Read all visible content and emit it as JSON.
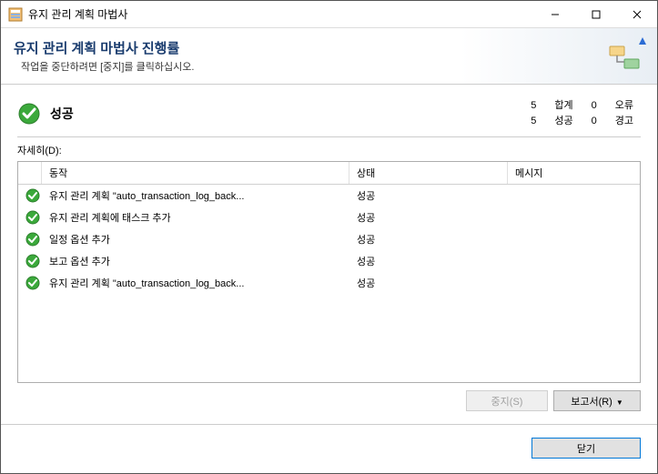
{
  "titlebar": {
    "title": "유지 관리 계획 마법사"
  },
  "banner": {
    "heading": "유지 관리 계획 마법사 진행률",
    "subtext": "작업을 중단하려면 [중지]를 클릭하십시오."
  },
  "summary": {
    "status_label": "성공",
    "stats": {
      "total_num": "5",
      "total_label": "합계",
      "error_num": "0",
      "error_label": "오류",
      "success_num": "5",
      "success_label": "성공",
      "warn_num": "0",
      "warn_label": "경고"
    }
  },
  "detail_label": "자세히(D):",
  "columns": {
    "action": "동작",
    "status": "상태",
    "message": "메시지"
  },
  "rows": [
    {
      "action": "유지 관리 계획 \"auto_transaction_log_back...",
      "status": "성공",
      "message": ""
    },
    {
      "action": "유지 관리 계획에 태스크 추가",
      "status": "성공",
      "message": ""
    },
    {
      "action": "일정 옵션 추가",
      "status": "성공",
      "message": ""
    },
    {
      "action": "보고 옵션 추가",
      "status": "성공",
      "message": ""
    },
    {
      "action": "유지 관리 계획 \"auto_transaction_log_back...",
      "status": "성공",
      "message": ""
    }
  ],
  "buttons": {
    "stop": "중지(S)",
    "report": "보고서(R)",
    "close": "닫기"
  }
}
